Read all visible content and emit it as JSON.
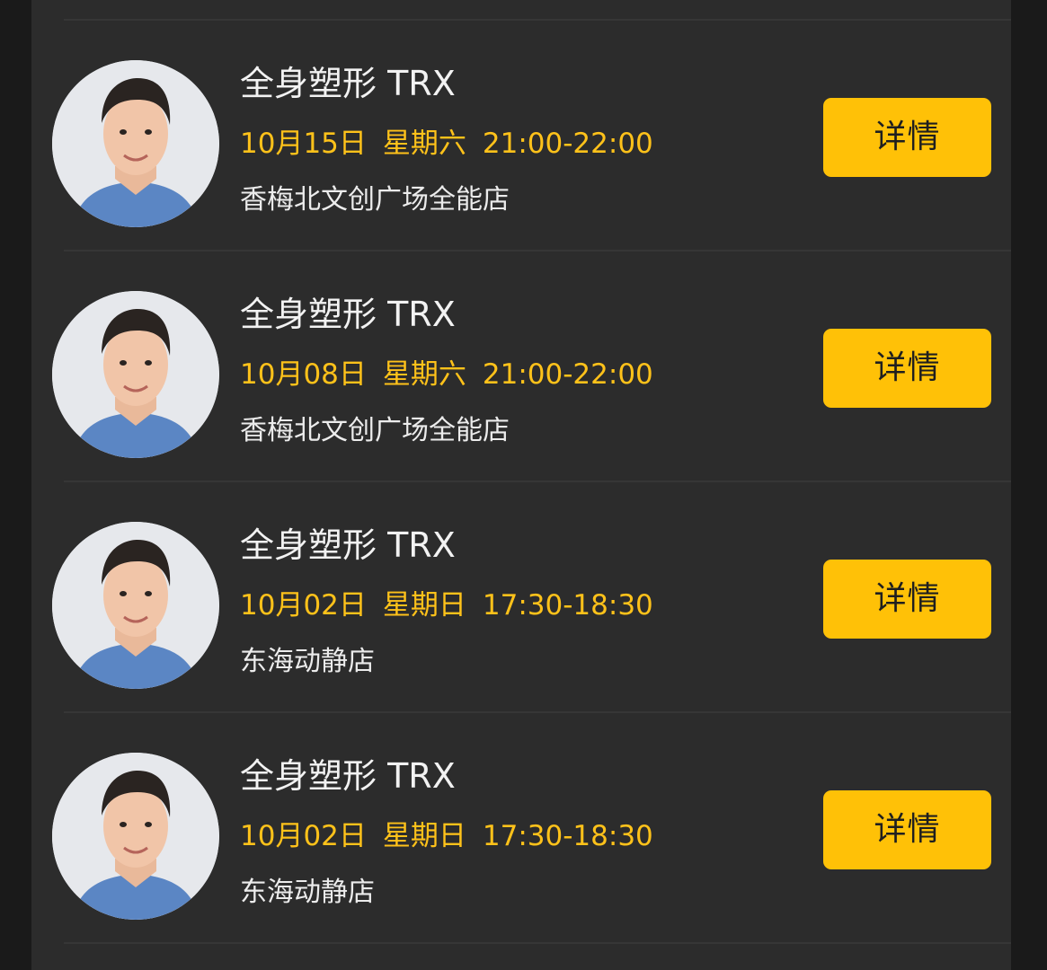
{
  "colors": {
    "background": "#1a1a1a",
    "panel": "#2c2c2c",
    "accent": "#ffc107",
    "time_text": "#ffc21a"
  },
  "classes": [
    {
      "title": "全身塑形 TRX",
      "date": "10月15日",
      "weekday": "星期六",
      "time_range": "21:00-22:00",
      "store": "香梅北文创广场全能店",
      "button": "详情",
      "avatar_icon": "coach-avatar"
    },
    {
      "title": "全身塑形 TRX",
      "date": "10月08日",
      "weekday": "星期六",
      "time_range": "21:00-22:00",
      "store": "香梅北文创广场全能店",
      "button": "详情",
      "avatar_icon": "coach-avatar"
    },
    {
      "title": "全身塑形 TRX",
      "date": "10月02日",
      "weekday": "星期日",
      "time_range": "17:30-18:30",
      "store": "东海动静店",
      "button": "详情",
      "avatar_icon": "coach-avatar"
    },
    {
      "title": "全身塑形 TRX",
      "date": "10月02日",
      "weekday": "星期日",
      "time_range": "17:30-18:30",
      "store": "东海动静店",
      "button": "详情",
      "avatar_icon": "coach-avatar"
    }
  ]
}
